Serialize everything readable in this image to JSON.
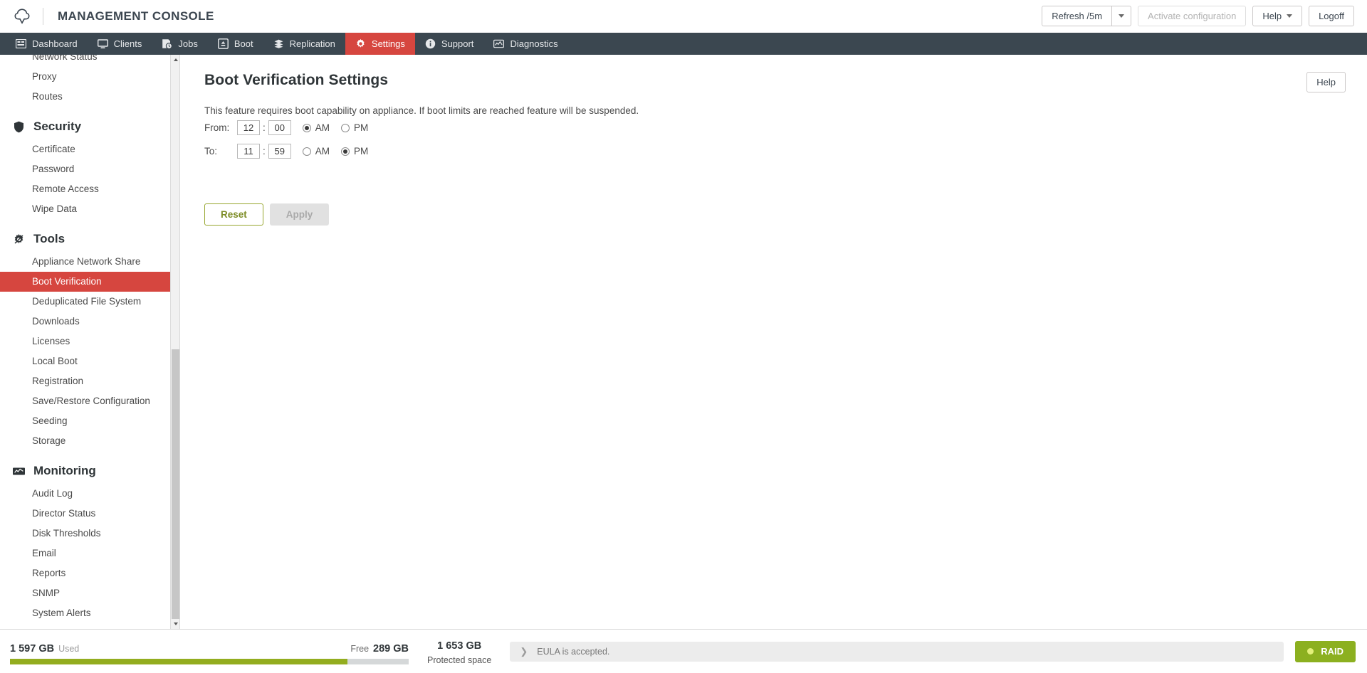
{
  "header": {
    "logo_icon": "cloud-shield-logo",
    "title": "MANAGEMENT CONSOLE",
    "refresh_label": "Refresh /5m",
    "activate_label": "Activate configuration",
    "help_label": "Help",
    "logoff_label": "Logoff"
  },
  "nav": {
    "items": [
      {
        "label": "Dashboard",
        "icon": "dashboard-icon",
        "active": false
      },
      {
        "label": "Clients",
        "icon": "monitor-icon",
        "active": false
      },
      {
        "label": "Jobs",
        "icon": "jobs-icon",
        "active": false
      },
      {
        "label": "Boot",
        "icon": "boot-icon",
        "active": false
      },
      {
        "label": "Replication",
        "icon": "layers-icon",
        "active": false
      },
      {
        "label": "Settings",
        "icon": "gear-icon",
        "active": true
      },
      {
        "label": "Support",
        "icon": "info-icon",
        "active": false
      },
      {
        "label": "Diagnostics",
        "icon": "diagnostics-icon",
        "active": false
      }
    ]
  },
  "sidebar": {
    "top_items": [
      {
        "label": "Network Status",
        "active": false
      },
      {
        "label": "Proxy",
        "active": false
      },
      {
        "label": "Routes",
        "active": false
      }
    ],
    "groups": [
      {
        "label": "Security",
        "icon": "shield-icon",
        "items": [
          {
            "label": "Certificate",
            "active": false
          },
          {
            "label": "Password",
            "active": false
          },
          {
            "label": "Remote Access",
            "active": false
          },
          {
            "label": "Wipe Data",
            "active": false
          }
        ]
      },
      {
        "label": "Tools",
        "icon": "tools-gear-icon",
        "items": [
          {
            "label": "Appliance Network Share",
            "active": false
          },
          {
            "label": "Boot Verification",
            "active": true
          },
          {
            "label": "Deduplicated File System",
            "active": false
          },
          {
            "label": "Downloads",
            "active": false
          },
          {
            "label": "Licenses",
            "active": false
          },
          {
            "label": "Local Boot",
            "active": false
          },
          {
            "label": "Registration",
            "active": false
          },
          {
            "label": "Save/Restore Configuration",
            "active": false
          },
          {
            "label": "Seeding",
            "active": false
          },
          {
            "label": "Storage",
            "active": false
          }
        ]
      },
      {
        "label": "Monitoring",
        "icon": "chart-line-icon",
        "items": [
          {
            "label": "Audit Log",
            "active": false
          },
          {
            "label": "Director Status",
            "active": false
          },
          {
            "label": "Disk Thresholds",
            "active": false
          },
          {
            "label": "Email",
            "active": false
          },
          {
            "label": "Reports",
            "active": false
          },
          {
            "label": "SNMP",
            "active": false
          },
          {
            "label": "System Alerts",
            "active": false
          }
        ]
      }
    ]
  },
  "main": {
    "title": "Boot Verification Settings",
    "help_label": "Help",
    "description": "This feature requires boot capability on appliance. If boot limits are reached feature will be suspended.",
    "from": {
      "label": "From:",
      "hour": "12",
      "minute": "00",
      "separator": ":",
      "am_label": "AM",
      "pm_label": "PM",
      "meridiem": "AM"
    },
    "to": {
      "label": "To:",
      "hour": "11",
      "minute": "59",
      "separator": ":",
      "am_label": "AM",
      "pm_label": "PM",
      "meridiem": "PM"
    },
    "reset_label": "Reset",
    "apply_label": "Apply"
  },
  "footer": {
    "used_value": "1 597 GB",
    "used_label": "Used",
    "free_label": "Free",
    "free_value": "289 GB",
    "protected_value": "1 653 GB",
    "protected_label": "Protected space",
    "usage_percent": 84.6,
    "eula_text": "EULA is accepted.",
    "raid_label": "RAID"
  },
  "colors": {
    "accent_red": "#d6463f",
    "navbar": "#3b4750",
    "olive": "#97a62e",
    "usage_green": "#93ad1f",
    "raid_green": "#8cb020"
  }
}
